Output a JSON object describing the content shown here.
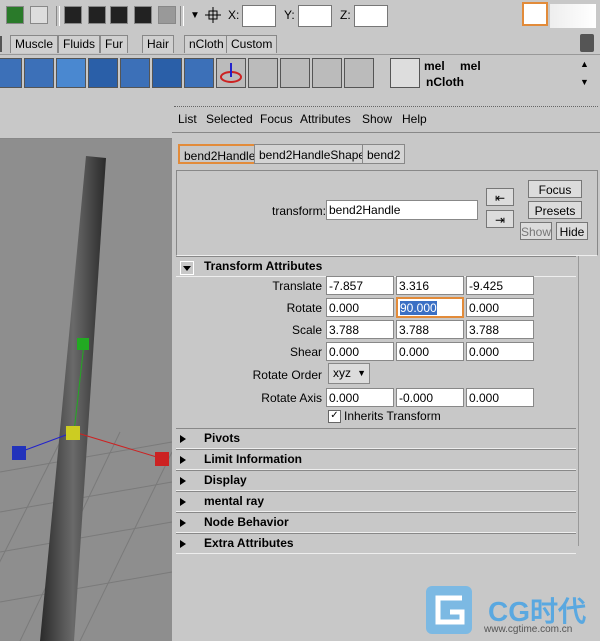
{
  "toolbar": {
    "x_label": "X:",
    "y_label": "Y:",
    "z_label": "Z:"
  },
  "shelf": {
    "tabs": [
      "Muscle",
      "Fluids",
      "Fur",
      "Hair",
      "nCloth",
      "Custom"
    ],
    "mel_label_1": "mel",
    "mel_label_2": "mel",
    "ncloth_label": "nCloth"
  },
  "attribute_editor": {
    "menu": [
      "List",
      "Selected",
      "Focus",
      "Attributes",
      "Show",
      "Help"
    ],
    "tabs": [
      "bend2Handle",
      "bend2HandleShape",
      "bend2"
    ],
    "transform_label": "transform:",
    "transform_value": "bend2Handle",
    "buttons": {
      "focus": "Focus",
      "presets": "Presets",
      "show": "Show",
      "hide": "Hide"
    },
    "transform_attributes": {
      "title": "Transform Attributes",
      "rows": [
        {
          "label": "Translate",
          "values": [
            "-7.857",
            "3.316",
            "-9.425"
          ]
        },
        {
          "label": "Rotate",
          "values": [
            "0.000",
            "90.000",
            "0.000"
          ]
        },
        {
          "label": "Scale",
          "values": [
            "3.788",
            "3.788",
            "3.788"
          ]
        },
        {
          "label": "Shear",
          "values": [
            "0.000",
            "0.000",
            "0.000"
          ]
        }
      ],
      "rotate_order_label": "Rotate Order",
      "rotate_order_value": "xyz",
      "rotate_axis_label": "Rotate Axis",
      "rotate_axis_values": [
        "0.000",
        "-0.000",
        "0.000"
      ],
      "inherits_transform_label": "Inherits Transform",
      "inherits_transform_checked": true
    },
    "sections": [
      "Pivots",
      "Limit Information",
      "Display",
      "mental ray",
      "Node Behavior",
      "Extra Attributes"
    ]
  },
  "watermark": {
    "brand": "CG时代",
    "url": "www.cgtime.com.cn"
  },
  "colors": {
    "highlight": "#e28b3a",
    "manip_red": "#cc2222",
    "manip_blue": "#2233bb",
    "manip_green": "#22aa22",
    "manip_yellow": "#cccc22"
  }
}
